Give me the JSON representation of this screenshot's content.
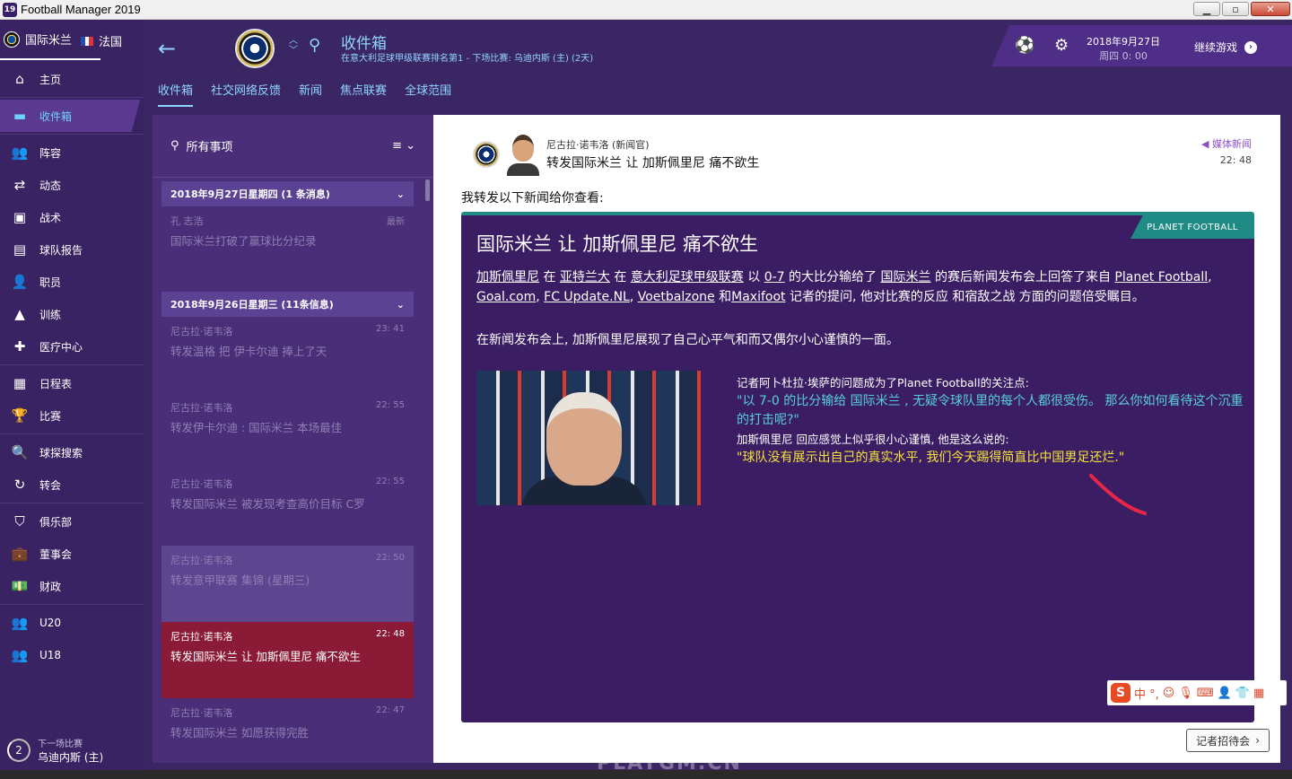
{
  "window": {
    "title": "Football Manager 2019",
    "app_icon": "19"
  },
  "sidebar": {
    "club": "国际米兰",
    "country": "法国",
    "items": [
      {
        "label": "主页",
        "icon": "home-icon",
        "glyph": "⌂"
      },
      {
        "label": "收件箱",
        "icon": "inbox-icon",
        "glyph": "▬"
      },
      {
        "label": "阵容",
        "icon": "squad-icon",
        "glyph": "👥"
      },
      {
        "label": "动态",
        "icon": "dynamics-icon",
        "glyph": "⇄"
      },
      {
        "label": "战术",
        "icon": "tactics-icon",
        "glyph": "▣"
      },
      {
        "label": "球队报告",
        "icon": "report-icon",
        "glyph": "▤"
      },
      {
        "label": "职员",
        "icon": "staff-icon",
        "glyph": "👤"
      },
      {
        "label": "训练",
        "icon": "training-icon",
        "glyph": "▲"
      },
      {
        "label": "医疗中心",
        "icon": "medical-icon",
        "glyph": "✚"
      },
      {
        "label": "日程表",
        "icon": "calendar-icon",
        "glyph": "▦"
      },
      {
        "label": "比赛",
        "icon": "trophy-icon",
        "glyph": "🏆"
      },
      {
        "label": "球探搜索",
        "icon": "scout-icon",
        "glyph": "🔍"
      },
      {
        "label": "转会",
        "icon": "transfer-icon",
        "glyph": "↻"
      },
      {
        "label": "俱乐部",
        "icon": "club-shield-icon",
        "glyph": "⛉"
      },
      {
        "label": "董事会",
        "icon": "board-icon",
        "glyph": "💼"
      },
      {
        "label": "财政",
        "icon": "finance-icon",
        "glyph": "💵"
      },
      {
        "label": "U20",
        "icon": "u20-icon",
        "glyph": "👥"
      },
      {
        "label": "U18",
        "icon": "u18-icon",
        "glyph": "👥"
      }
    ],
    "next_match": {
      "label": "下一场比赛",
      "opponent": "乌迪内斯 (主)",
      "days": "2"
    }
  },
  "header": {
    "title": "收件箱",
    "subtitle": "在意大利足球甲级联赛排名第1 - 下场比赛: 乌迪内斯 (主) (2天)",
    "tabs": [
      "收件箱",
      "社交网络反馈",
      "新闻",
      "焦点联赛",
      "全球范围"
    ],
    "date": "2018年9月27日",
    "weekday_time": "周四 0: 00",
    "continue_label": "继续游戏"
  },
  "msglist": {
    "filter_label": "所有事项",
    "groups": [
      {
        "date": "2018年9月27日星期四 (1 条消息)",
        "messages": [
          {
            "from": "孔 志浩",
            "time": "最新",
            "subject": "国际米兰打破了赢球比分纪录"
          }
        ]
      },
      {
        "date": "2018年9月26日星期三 (11条信息)",
        "messages": [
          {
            "from": "尼古拉·诺韦洛",
            "time": "23: 41",
            "subject": "转发温格 把 伊卡尔迪 捧上了天"
          },
          {
            "from": "尼古拉·诺韦洛",
            "time": "22: 55",
            "subject": "转发伊卡尔迪 : 国际米兰 本场最佳"
          },
          {
            "from": "尼古拉·诺韦洛",
            "time": "22: 55",
            "subject": "转发国际米兰 被发现考查高价目标 C罗"
          },
          {
            "from": "尼古拉·诺韦洛",
            "time": "22: 50",
            "subject": "转发意甲联赛 集锦 (星期三)"
          },
          {
            "from": "尼古拉·诺韦洛",
            "time": "22: 48",
            "subject": "转发国际米兰 让 加斯佩里尼 痛不欲生"
          },
          {
            "from": "尼古拉·诺韦洛",
            "time": "22: 47",
            "subject": "转发国际米兰 如愿获得完胜"
          }
        ]
      }
    ]
  },
  "reader": {
    "sender": "尼古拉·诺韦洛 (新闻官)",
    "subject": "转发国际米兰 让 加斯佩里尼 痛不欲生",
    "media_tag": "媒体新闻",
    "time": "22: 48",
    "intro": "我转发以下新闻给你查看:",
    "article": {
      "source": "PLANET FOOTBALL",
      "title": "国际米兰 让 加斯佩里尼 痛不欲生",
      "p1_parts": [
        {
          "t": "加斯佩里尼",
          "u": true
        },
        {
          "t": " 在 ",
          "u": false
        },
        {
          "t": "亚特兰大",
          "u": true
        },
        {
          "t": " 在 ",
          "u": false
        },
        {
          "t": "意大利足球甲级联赛",
          "u": true
        },
        {
          "t": " 以 ",
          "u": false
        },
        {
          "t": "0-7",
          "u": true
        },
        {
          "t": " 的大比分输给了 ",
          "u": false
        },
        {
          "t": "国际米兰",
          "u": true
        },
        {
          "t": " 的赛后新闻发布会上回答了来自 ",
          "u": false
        },
        {
          "t": "Planet Football",
          "u": true
        },
        {
          "t": ", ",
          "u": false
        },
        {
          "t": "Goal.com",
          "u": true
        },
        {
          "t": ", ",
          "u": false
        },
        {
          "t": "FC Update.NL",
          "u": true
        },
        {
          "t": ", ",
          "u": false
        },
        {
          "t": "Voetbalzone",
          "u": true
        },
        {
          "t": " 和",
          "u": false
        },
        {
          "t": "Maxifoot",
          "u": true
        },
        {
          "t": " 记者的提问, 他对比赛的反应 和宿敌之战 方面的问题倍受瞩目。",
          "u": false
        }
      ],
      "p2": "在新闻发布会上, 加斯佩里尼展现了自己心平气和而又偶尔小心谨慎的一面。",
      "q_intro": "记者阿卜杜拉·埃萨的问题成为了Planet Football的关注点:",
      "question": "\"以 7-0 的比分输给 国际米兰 , 无疑令球队里的每个人都很受伤。 那么你如何看待这个沉重的打击呢?\"",
      "a_intro": "加斯佩里尼 回应感觉上似乎很小心谨慎, 他是这么说的:",
      "answer": "\"球队没有展示出自己的真实水平, 我们今天踢得简直比中国男足还烂.\""
    },
    "ime_text": "中 °,",
    "press_button": "记者招待会"
  },
  "watermark": "PLAYGM.CN"
}
